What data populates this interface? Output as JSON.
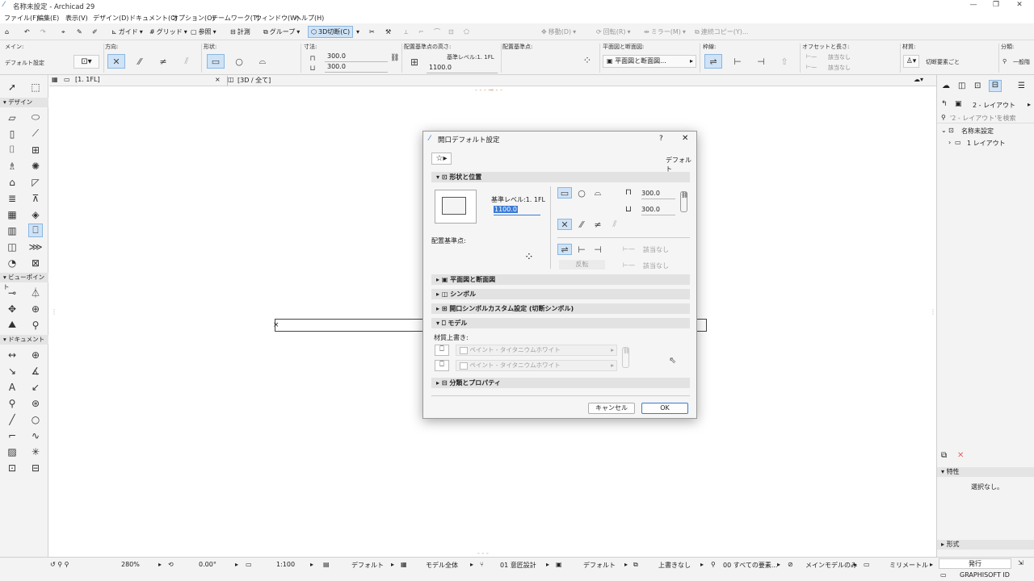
{
  "window": {
    "title": "名称未設定 - Archicad 29",
    "min": "—",
    "max": "❐",
    "close": "✕"
  },
  "menu": [
    "ファイル(F)",
    "編集(E)",
    "表示(V)",
    "デザイン(D)",
    "ドキュメント(C)",
    "オプション(O)",
    "チームワーク(T)",
    "ウィンドウ(W)",
    "ヘルプ(H)"
  ],
  "toolbar": {
    "guide": "ガイド",
    "grid": "グリッド",
    "reference": "参照",
    "measure": "計測",
    "group": "グループ",
    "cut3d": "3D切断(C)",
    "move": "移動(D)",
    "rotate": "回転(R)",
    "mirror": "ミラー(M)",
    "multicopy": "連続コピー(Y)..."
  },
  "infobox": {
    "main_label": "メイン:",
    "main_value": "デフォルト設定",
    "direction_label": "方向:",
    "shape_label": "形状:",
    "size_label": "寸法:",
    "width": "300.0",
    "height": "300.0",
    "anchor_label": "配置基準点の高さ:",
    "level": "基準レベル:1. 1FL",
    "level_value": "1100.0",
    "anchor2_label": "配置基準点:",
    "floorplan_label": "平面図と断面図:",
    "floorplan_value": "平面図と断面図...",
    "frame_label": "枠線:",
    "offset_label": "オフセットと長さ:",
    "offset1": "該当なし",
    "offset2": "該当なし",
    "material_label": "材質:",
    "material_value": "切断要素ごと",
    "class_label": "分類:",
    "class_value": "一般階"
  },
  "toolbox": {
    "design": "デザイン",
    "viewpoint": "ビューポイント",
    "document": "ドキュメント"
  },
  "tabs": {
    "plan": "[1. 1FL]",
    "view3d": "[3D / 全て]",
    "close": "×"
  },
  "rightpanel": {
    "layout": "2 - レイアウト",
    "search_placeholder": "'2 - レイアウト'を検索",
    "tree_root": "名称未設定",
    "tree_child": "1 レイアウト",
    "props_header": "特性",
    "props_none": "選択なし。",
    "format_header": "形式",
    "issue_button": "発行",
    "graphisoft": "GRAPHISOFT ID"
  },
  "status": {
    "zoom": "280%",
    "angle": "0.00°",
    "scale": "1:100",
    "pen": "デフォルト",
    "model": "モデル全体",
    "design": "01 意匠設計",
    "dim": "デフォルト",
    "override": "上書きなし",
    "elements": "00 すべての要素...",
    "main_model": "メインモデルのみ",
    "unit": "ミリメートル"
  },
  "dialog": {
    "title": "開口デフォルト設定",
    "help": "?",
    "close": "✕",
    "favorite_default": "デフォルト",
    "sec_shape": "形状と位置",
    "level_label": "基準レベル:1. 1FL",
    "level_value": "1100.0",
    "width": "300.0",
    "height": "300.0",
    "anchor_label": "配置基準点:",
    "flip": "反転",
    "na1": "該当なし",
    "na2": "該当なし",
    "sec_plan": "平面図と断面図",
    "sec_symbol": "シンボル",
    "sec_custom": "開口シンボルカスタム設定 (切断シンボル)",
    "sec_model": "モデル",
    "material_override": "材質上書き:",
    "paint1": "ペイント - タイタニウムホワイト",
    "paint2": "ペイント - タイタニウムホワイト",
    "sec_class": "分類とプロパティ",
    "cancel": "キャンセル",
    "ok": "OK"
  }
}
